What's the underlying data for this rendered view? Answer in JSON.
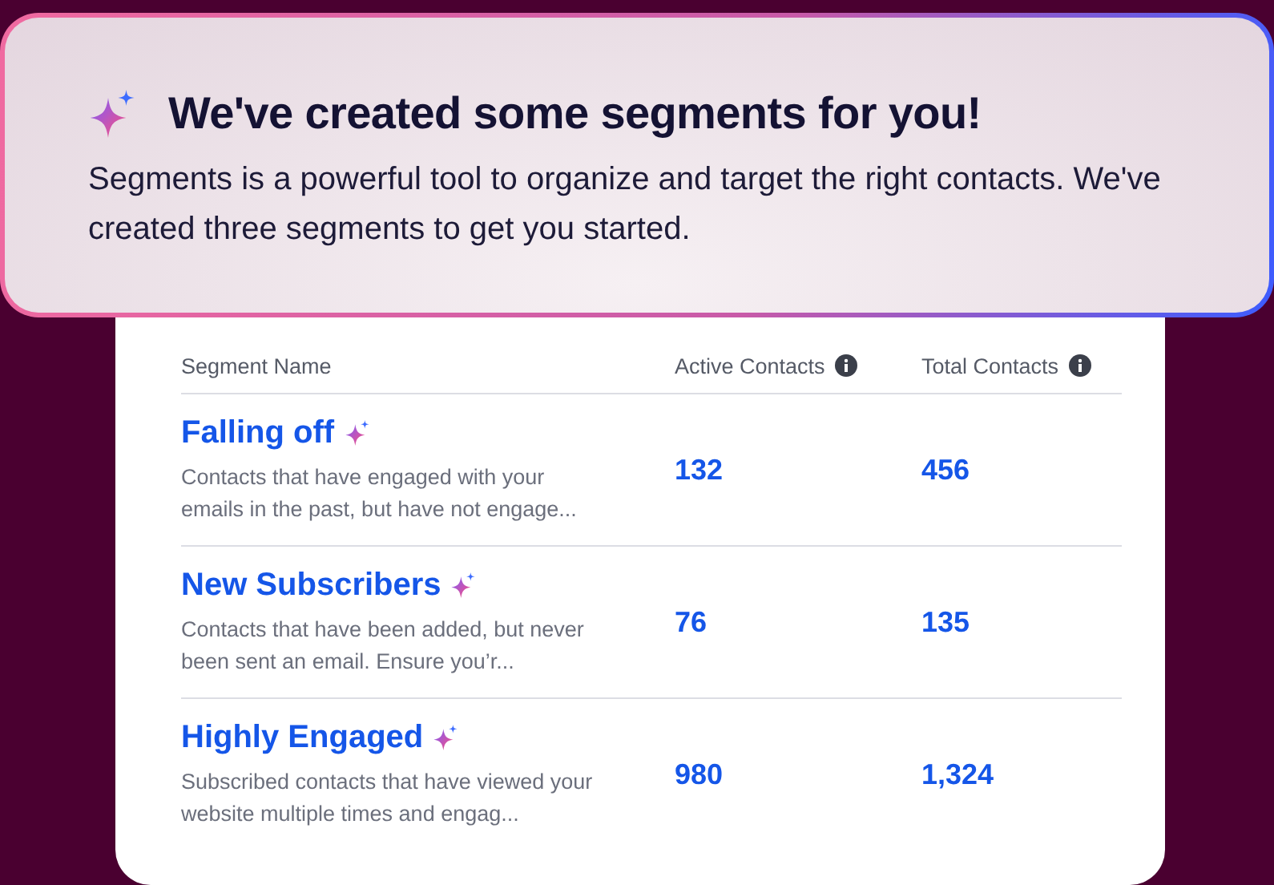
{
  "banner": {
    "title": "We've created some segments for you!",
    "text": "Segments is a powerful tool to organize and target the right contacts. We've created three segments to get you started."
  },
  "table": {
    "columns": [
      {
        "label": "Segment Name",
        "info": false
      },
      {
        "label": "Active Contacts",
        "info": true
      },
      {
        "label": "Total Contacts",
        "info": true
      }
    ],
    "rows": [
      {
        "name": "Falling off",
        "description": "Contacts that have engaged with your emails in the past, but have not engage...",
        "active": "132",
        "total": "456"
      },
      {
        "name": "New Subscribers",
        "description": "Contacts that have been added, but never been sent an email. Ensure you’r...",
        "active": "76",
        "total": "135"
      },
      {
        "name": "Highly Engaged",
        "description": "Subscribed contacts that have viewed your website multiple times and engag...",
        "active": "980",
        "total": "1,324"
      }
    ]
  }
}
